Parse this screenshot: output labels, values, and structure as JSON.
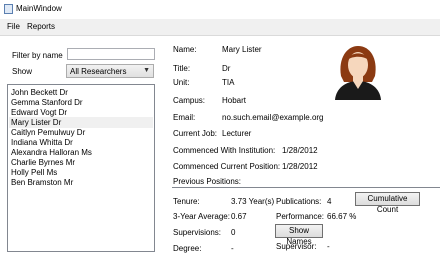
{
  "window": {
    "title": "MainWindow"
  },
  "menu": [
    "File",
    "Reports"
  ],
  "filter": {
    "label": "Filter by name",
    "value": ""
  },
  "show": {
    "label": "Show",
    "selected": "All Researchers"
  },
  "researchers": [
    "John Beckett Dr",
    "Gemma Stanford Dr",
    "Edward Vogt Dr",
    "Mary Lister Dr",
    "Caitlyn Pemulwuy Dr",
    "Indiana Whitta Dr",
    "Alexandra Halloran Ms",
    "Charlie Byrnes Mr",
    "Holly Pell Ms",
    "Ben Bramston Mr"
  ],
  "details": {
    "name": {
      "label": "Name:",
      "value": "Mary Lister"
    },
    "title": {
      "label": "Title:",
      "value": "Dr"
    },
    "unit": {
      "label": "Unit:",
      "value": "TIA"
    },
    "campus": {
      "label": "Campus:",
      "value": "Hobart"
    },
    "email": {
      "label": "Email:",
      "value": "no.such.email@example.org"
    },
    "current_job": {
      "label": "Current Job:",
      "value": "Lecturer"
    },
    "commenced_institution": {
      "label": "Commenced With Institution:",
      "value": "1/28/2012"
    },
    "commenced_position": {
      "label": "Commenced Current Position:",
      "value": "1/28/2012"
    },
    "previous_positions": {
      "label": "Previous Positions:"
    }
  },
  "stats": {
    "tenure": {
      "label": "Tenure:",
      "value": "3.73 Year(s)"
    },
    "publications": {
      "label": "Publications:",
      "value": "4"
    },
    "three_year_avg": {
      "label": "3-Year Average:",
      "value": "0.67"
    },
    "performance": {
      "label": "Performance:",
      "value": "66.67 %"
    },
    "supervisions": {
      "label": "Supervisions:",
      "value": "0"
    },
    "degree": {
      "label": "Degree:",
      "value": "-"
    },
    "supervisor": {
      "label": "Supervisor:",
      "value": "-"
    }
  },
  "buttons": {
    "cumulative_count": "Cumulative Count",
    "show_names": "Show Names"
  },
  "icons": {
    "avatar": "female-avatar-icon",
    "app": "window-icon"
  },
  "colors": {
    "hair": "#8b3a12",
    "skin": "#f6d7bd",
    "shirt": "#1a1a1a"
  }
}
